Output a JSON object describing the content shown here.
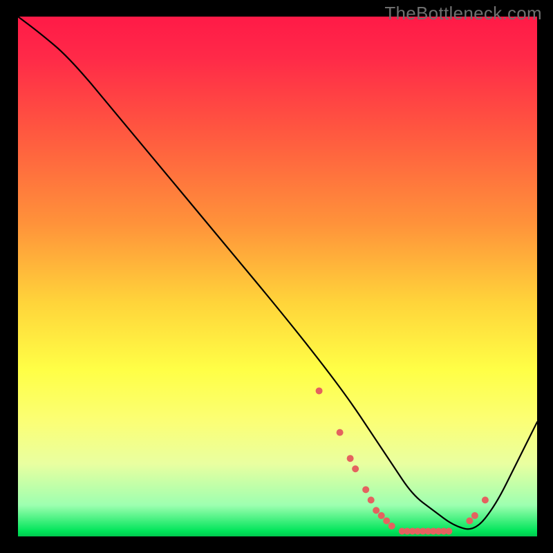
{
  "watermark": "TheBottleneck.com",
  "chart_data": {
    "type": "line",
    "title": "",
    "xlabel": "",
    "ylabel": "",
    "xlim": [
      0,
      100
    ],
    "ylim": [
      0,
      100
    ],
    "grid": false,
    "legend": false,
    "series": [
      {
        "name": "curve",
        "color": "#000000",
        "x": [
          0,
          4,
          10,
          20,
          30,
          40,
          50,
          58,
          64,
          68,
          72,
          76,
          80,
          84,
          88,
          92,
          96,
          100
        ],
        "values": [
          100,
          97,
          92,
          80,
          68,
          56,
          44,
          34,
          26,
          20,
          14,
          8,
          5,
          2,
          1,
          6,
          14,
          22
        ]
      }
    ],
    "markers": {
      "name": "dots",
      "color": "#e4625f",
      "radius": 5,
      "x": [
        58,
        62,
        64,
        65,
        67,
        68,
        69,
        70,
        71,
        72,
        74,
        75,
        76,
        77,
        78,
        79,
        80,
        81,
        82,
        83,
        87,
        88,
        90
      ],
      "values": [
        28,
        20,
        15,
        13,
        9,
        7,
        5,
        4,
        3,
        2,
        1,
        1,
        1,
        1,
        1,
        1,
        1,
        1,
        1,
        1,
        3,
        4,
        7
      ]
    }
  }
}
